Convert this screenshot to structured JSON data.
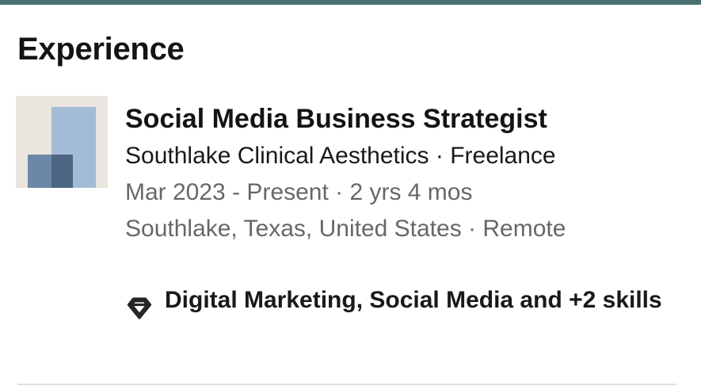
{
  "section": {
    "title": "Experience"
  },
  "experience": {
    "logo_icon": "company-logo-icon",
    "job_title": "Social Media Business Strategist",
    "company_line": "Southlake Clinical Aesthetics · Freelance",
    "date_line": "Mar 2023 - Present · 2 yrs 4 mos",
    "location_line": "Southlake, Texas, United States · Remote",
    "skills_icon": "diamond-icon",
    "skills_line": "Digital Marketing, Social Media and +2 skills"
  },
  "colors": {
    "top_bar": "#4a7171",
    "logo_background": "#e9e5df",
    "logo_light": "#a3bbd4",
    "logo_dark": "#6b88a8"
  }
}
